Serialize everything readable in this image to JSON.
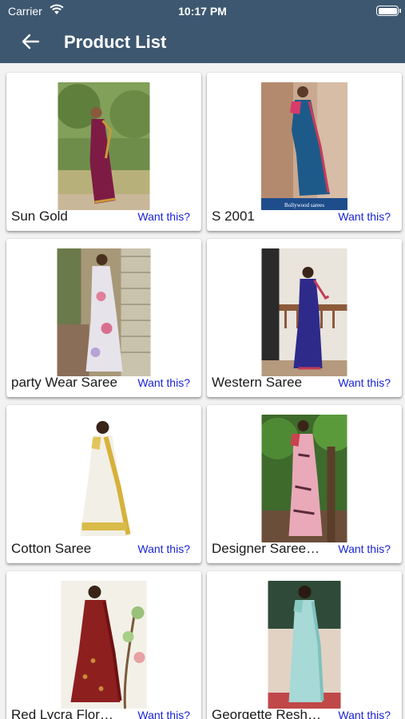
{
  "status": {
    "carrier": "Carrier",
    "time": "10:17 PM"
  },
  "header": {
    "title": "Product List"
  },
  "colors": {
    "header_bg": "#3d5770",
    "link": "#1a23d6"
  },
  "products": [
    {
      "name": "Sun Gold",
      "action": "Want this?"
    },
    {
      "name": "S 2001",
      "action": "Want this?",
      "image_caption": "Bollywood sarees"
    },
    {
      "name": "party Wear Saree",
      "action": "Want this?"
    },
    {
      "name": "Western Saree",
      "action": "Want this?"
    },
    {
      "name": "Cotton Saree",
      "action": "Want this?"
    },
    {
      "name": "Designer Saree…",
      "action": "Want this?"
    },
    {
      "name": "Red Lycra Flor…",
      "action": "Want this?"
    },
    {
      "name": "Georgette Resh…",
      "action": "Want this?"
    }
  ]
}
